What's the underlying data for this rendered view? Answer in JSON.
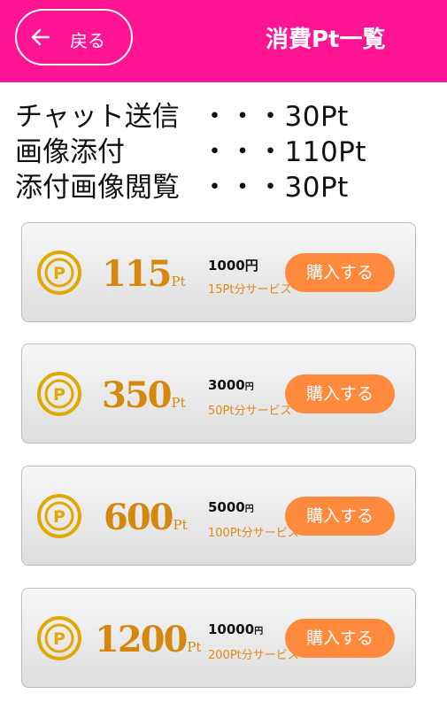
{
  "header": {
    "back_label": "戻る",
    "title": "消費Pt一覧",
    "bg_color": "#ff1493"
  },
  "costs": [
    {
      "name": "チャット送信",
      "value": "・・・30Pt"
    },
    {
      "name": "画像添付",
      "value": "・・・110Pt"
    },
    {
      "name": "添付画像閲覧",
      "value": "・・・30Pt"
    }
  ],
  "plans": [
    {
      "points": "115",
      "unit": "Pt",
      "price": "1000",
      "yen": "円",
      "bonus": "15Pt分サービス",
      "button": "購入する"
    },
    {
      "points": "350",
      "unit": "Pt",
      "price": "3000",
      "yen": "円",
      "bonus": "50Pt分サービス",
      "button": "購入する"
    },
    {
      "points": "600",
      "unit": "Pt",
      "price": "5000",
      "yen": "円",
      "bonus": "100Pt分サービス",
      "button": "購入する"
    },
    {
      "points": "1200",
      "unit": "Pt",
      "price": "10000",
      "yen": "円",
      "bonus": "200Pt分サービス",
      "button": "購入する"
    }
  ],
  "icons": {
    "coin": "coin-p-icon",
    "back": "arrow-left-icon"
  },
  "colors": {
    "accent": "#ff8a3d",
    "points": "#d4890e",
    "coin": "#e0a800"
  }
}
